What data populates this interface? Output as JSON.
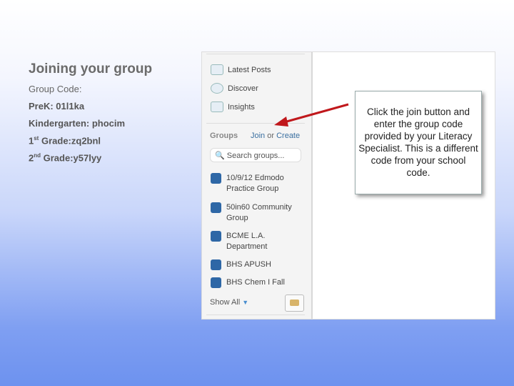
{
  "instructions": {
    "title": "Joining your group",
    "subtitle": "Group Code:",
    "codes": [
      {
        "label": "PreK: 01l1ka"
      },
      {
        "label": "Kindergarten: phocim"
      },
      {
        "num": "1",
        "sup": "st",
        "label": " Grade:zq2bnl"
      },
      {
        "num": "2",
        "sup": "nd",
        "label": " Grade:y57lyy"
      }
    ]
  },
  "sidebar": {
    "nav": [
      "Latest Posts",
      "Discover",
      "Insights"
    ],
    "groups_label": "Groups",
    "join": "Join",
    "or": "or",
    "create": "Create",
    "search_placeholder": "Search groups...",
    "groups": [
      "10/9/12 Edmodo Practice Group",
      "50in60 Community Group",
      "BCME L.A. Department",
      "BHS APUSH",
      "BHS Chem I Fall"
    ],
    "show_all": "Show All"
  },
  "callout": "Click the join button and enter the group code provided by your Literacy Specialist. This is a different code from your school code.",
  "colors": {
    "group": "#2e67a6",
    "arrow": "#c0181c",
    "link": "#3a6fa0"
  }
}
